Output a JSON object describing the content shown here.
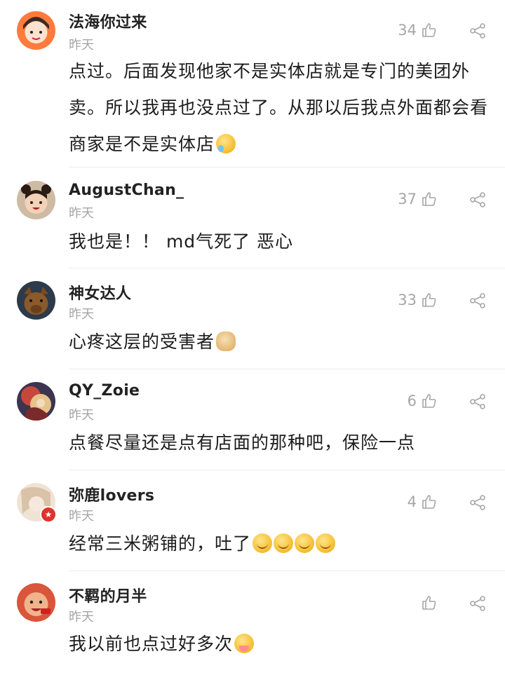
{
  "comments": [
    {
      "username": "法海你过来",
      "time": "昨天",
      "likes": "34",
      "text": "点过。后面发现他家不是实体店就是专门的美团外卖。所以我再也没点过了。从那以后我点外面都会看商家是不是实体店",
      "emoji": "laugh-cry-emoji",
      "avatar_color": "#ff7b3d"
    },
    {
      "username": "AugustChan_",
      "time": "昨天",
      "likes": "37",
      "text": "我也是！！ md气死了 恶心",
      "avatar_color": "#c7b49a"
    },
    {
      "username": "神女达人",
      "time": "昨天",
      "likes": "33",
      "text": "心疼这层的受害者",
      "emoji": "doge-emoji",
      "avatar_color": "#2c3a4a"
    },
    {
      "username": "QY_Zoie",
      "time": "昨天",
      "likes": "6",
      "text": "点餐尽量还是点有店面的那种吧，保险一点",
      "avatar_color": "#b8413a"
    },
    {
      "username": "弥鹿lovers",
      "time": "昨天",
      "likes": "4",
      "text": "经常三米粥铺的，吐了",
      "emoji": "vomit-emoji-x4",
      "avatar_color": "#e8d9c8",
      "verified_badge_color": "#e0322b"
    },
    {
      "username": "不羁的月半",
      "time": "昨天",
      "likes": "",
      "text": "我以前也点过好多次",
      "emoji": "sob-emoji",
      "avatar_color": "#e9a070"
    }
  ],
  "icons": {
    "like": "thumbs-up-icon",
    "share": "share-icon"
  },
  "colors": {
    "meta_gray": "#a6a6a6",
    "divider": "#ececec"
  }
}
